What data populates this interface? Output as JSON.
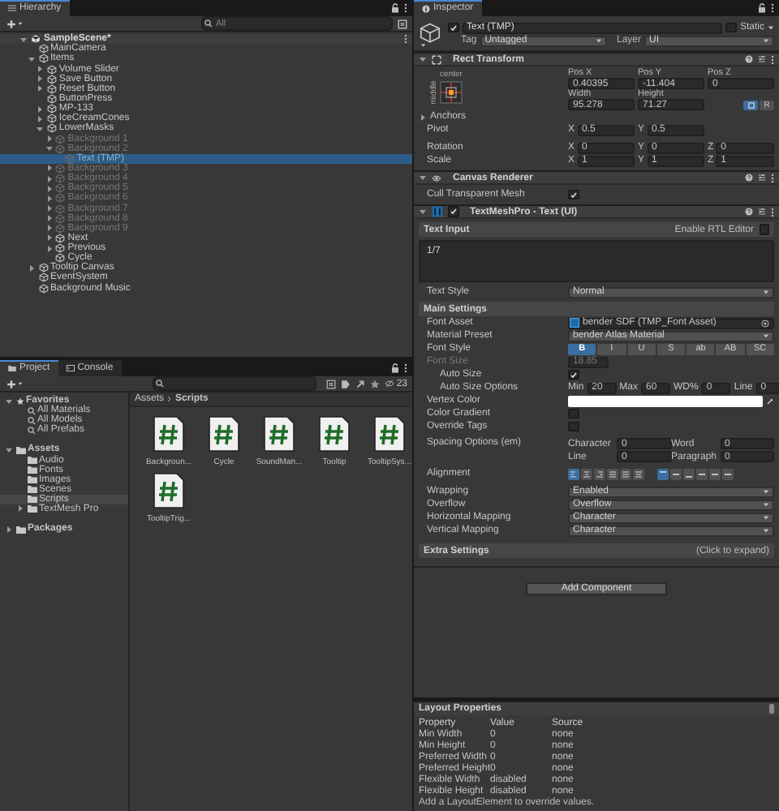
{
  "hierarchy": {
    "title": "Hierarchy",
    "search": {
      "placeholder": "All"
    },
    "scene": {
      "name": "SampleScene*",
      "expanded": true
    },
    "tree": [
      {
        "name": "MainCamera",
        "disabled": false,
        "selected": false
      },
      {
        "name": "Items",
        "expanded": true,
        "disabled": false,
        "selected": false,
        "children": [
          {
            "name": "Volume Slider",
            "expanded": false,
            "disabled": false,
            "selected": false
          },
          {
            "name": "Save Button",
            "expanded": false,
            "disabled": false,
            "selected": false
          },
          {
            "name": "Reset Button",
            "expanded": false,
            "disabled": false,
            "selected": false
          },
          {
            "name": "ButtonPress",
            "disabled": false,
            "selected": false
          },
          {
            "name": "MP-133",
            "expanded": false,
            "disabled": false,
            "selected": false
          },
          {
            "name": "IceCreamCones",
            "expanded": false,
            "disabled": false,
            "selected": false
          },
          {
            "name": "LowerMasks",
            "expanded": true,
            "disabled": false,
            "selected": false,
            "children": [
              {
                "name": "Background 1",
                "expanded": false,
                "disabled": true,
                "selected": false
              },
              {
                "name": "Background 2",
                "expanded": true,
                "disabled": true,
                "selected": false,
                "children": [
                  {
                    "name": "Text (TMP)",
                    "disabled": true,
                    "selected": true
                  }
                ]
              },
              {
                "name": "Background 3",
                "expanded": false,
                "disabled": true,
                "selected": false
              },
              {
                "name": "Background 4",
                "expanded": false,
                "disabled": true,
                "selected": false
              },
              {
                "name": "Background 5",
                "expanded": false,
                "disabled": true,
                "selected": false
              },
              {
                "name": "Background 6",
                "expanded": false,
                "disabled": true,
                "selected": false
              },
              {
                "name": "Background 7",
                "expanded": false,
                "disabled": true,
                "selected": false
              },
              {
                "name": "Background 8",
                "expanded": false,
                "disabled": true,
                "selected": false
              },
              {
                "name": "Background 9",
                "expanded": false,
                "disabled": true,
                "selected": false
              },
              {
                "name": "Next",
                "expanded": false,
                "disabled": false,
                "selected": false
              },
              {
                "name": "Previous",
                "expanded": false,
                "disabled": false,
                "selected": false
              },
              {
                "name": "Cycle",
                "disabled": false,
                "selected": false
              }
            ]
          }
        ]
      },
      {
        "name": "Tooltip Canvas",
        "expanded": false,
        "disabled": false,
        "selected": false
      },
      {
        "name": "EventSystem",
        "disabled": false,
        "selected": false
      },
      {
        "name": "Background Music",
        "disabled": false,
        "selected": false
      }
    ]
  },
  "project": {
    "tabs": [
      {
        "label": "Project",
        "selected": true
      },
      {
        "label": "Console",
        "selected": false
      }
    ],
    "hidden_count": "23",
    "tree": [
      {
        "name": "Favorites",
        "kind": "favorites",
        "expanded": true,
        "selected": false,
        "children": [
          {
            "name": "All Materials",
            "kind": "search",
            "selected": false
          },
          {
            "name": "All Models",
            "kind": "search",
            "selected": false
          },
          {
            "name": "All Prefabs",
            "kind": "search",
            "selected": false
          }
        ]
      },
      {
        "name": "Assets",
        "kind": "folder",
        "expanded": true,
        "selected": false,
        "children": [
          {
            "name": "Audio",
            "kind": "folder",
            "selected": false
          },
          {
            "name": "Fonts",
            "kind": "folder",
            "selected": false
          },
          {
            "name": "Images",
            "kind": "folder",
            "selected": false
          },
          {
            "name": "Scenes",
            "kind": "folder",
            "selected": false
          },
          {
            "name": "Scripts",
            "kind": "folder",
            "selected": true
          },
          {
            "name": "TextMesh Pro",
            "kind": "folder",
            "expanded": false,
            "selected": false
          }
        ]
      },
      {
        "name": "Packages",
        "kind": "folder",
        "expanded": false,
        "selected": false
      }
    ],
    "breadcrumb": [
      "Assets",
      "Scripts"
    ],
    "files": [
      {
        "name": "Backgroun..."
      },
      {
        "name": "Cycle"
      },
      {
        "name": "SoundMan..."
      },
      {
        "name": "Tooltip"
      },
      {
        "name": "TooltipSys..."
      },
      {
        "name": "TooltipTrig..."
      }
    ]
  },
  "inspector": {
    "title": "Inspector",
    "object": {
      "active": true,
      "name": "Text (TMP)",
      "static": false,
      "static_label": "Static",
      "tag_label": "Tag",
      "tag": "Untagged",
      "layer_label": "Layer",
      "layer": "UI"
    },
    "rect_transform": {
      "title": "Rect Transform",
      "anchor_h": "center",
      "anchor_v": "middle",
      "fields": [
        {
          "label": "Pos X",
          "value": "0.40395"
        },
        {
          "label": "Pos Y",
          "value": "-11.404"
        },
        {
          "label": "Pos Z",
          "value": "0"
        },
        {
          "label": "Width",
          "value": "95.278"
        },
        {
          "label": "Height",
          "value": "71.27"
        }
      ],
      "blueprint": true,
      "raw_label": "R",
      "anchors": {
        "label": "Anchors",
        "expanded": false
      },
      "rows": [
        {
          "label": "Pivot",
          "values": [
            {
              "axis": "X",
              "value": "0.5"
            },
            {
              "axis": "Y",
              "value": "0.5"
            }
          ]
        },
        {
          "label": "Rotation",
          "values": [
            {
              "axis": "X",
              "value": "0"
            },
            {
              "axis": "Y",
              "value": "0"
            },
            {
              "axis": "Z",
              "value": "0"
            }
          ]
        },
        {
          "label": "Scale",
          "values": [
            {
              "axis": "X",
              "value": "1"
            },
            {
              "axis": "Y",
              "value": "1"
            },
            {
              "axis": "Z",
              "value": "1"
            }
          ]
        }
      ]
    },
    "canvas_renderer": {
      "title": "Canvas Renderer",
      "rows": [
        {
          "label": "Cull Transparent Mesh",
          "checked": true
        }
      ]
    },
    "tmp": {
      "title": "TextMeshPro - Text (UI)",
      "enabled": true,
      "text_input": {
        "title": "Text Input",
        "rtl_label": "Enable RTL Editor",
        "rtl": false,
        "value": "1/7"
      },
      "rows": [
        {
          "kind": "dropdown",
          "label": "Text Style",
          "value": "Normal"
        },
        {
          "kind": "header",
          "label": "Main Settings"
        },
        {
          "kind": "object",
          "label": "Font Asset",
          "value": "bender SDF (TMP_Font Asset)"
        },
        {
          "kind": "dropdown",
          "label": "Material Preset",
          "value": "bender Atlas Material"
        },
        {
          "kind": "buttons",
          "label": "Font Style",
          "buttons": [
            {
              "label": "B",
              "selected": true
            },
            {
              "label": "I",
              "selected": false
            },
            {
              "label": "U",
              "selected": false
            },
            {
              "label": "S",
              "selected": false
            },
            {
              "label": "ab",
              "selected": false
            },
            {
              "label": "AB",
              "selected": false
            },
            {
              "label": "SC",
              "selected": false
            }
          ]
        },
        {
          "kind": "number",
          "label": "Font Size",
          "value": "18.85",
          "disabled": true,
          "children": [
            {
              "kind": "check",
              "label": "Auto Size",
              "checked": true
            },
            {
              "kind": "pairs",
              "label": "Auto Size Options",
              "fields": [
                {
                  "label": "Min",
                  "value": "20"
                },
                {
                  "label": "Max",
                  "value": "60"
                },
                {
                  "label": "WD%",
                  "value": "0"
                },
                {
                  "label": "Line",
                  "value": "0"
                }
              ]
            }
          ]
        },
        {
          "kind": "color",
          "label": "Vertex Color",
          "color": "#ffffff"
        },
        {
          "kind": "check",
          "label": "Color Gradient",
          "checked": false
        },
        {
          "kind": "check",
          "label": "Override Tags",
          "checked": false
        },
        {
          "kind": "grid",
          "label": "Spacing Options (em)",
          "fields": [
            {
              "label": "Character",
              "value": "0"
            },
            {
              "label": "Word",
              "value": "0"
            },
            {
              "label": "Line",
              "value": "0"
            },
            {
              "label": "Paragraph",
              "value": "0"
            }
          ]
        },
        {
          "kind": "alignment",
          "label": "Alignment",
          "horizontal": [
            {
              "selected": true
            },
            {
              "selected": false
            },
            {
              "selected": false
            },
            {
              "selected": false
            },
            {
              "selected": false
            },
            {
              "selected": false
            }
          ],
          "vertical": [
            {
              "selected": true
            },
            {
              "selected": false
            },
            {
              "selected": false
            },
            {
              "selected": false
            },
            {
              "selected": false
            },
            {
              "selected": false
            }
          ]
        },
        {
          "kind": "dropdown",
          "label": "Wrapping",
          "value": "Enabled"
        },
        {
          "kind": "dropdown",
          "label": "Overflow",
          "value": "Overflow"
        },
        {
          "kind": "dropdown",
          "label": "Horizontal Mapping",
          "value": "Character"
        },
        {
          "kind": "dropdown",
          "label": "Vertical Mapping",
          "value": "Character"
        },
        {
          "kind": "foldout",
          "label": "Extra Settings",
          "hint": "(Click to expand)",
          "expanded": false
        }
      ]
    },
    "add_component": "Add Component"
  },
  "layout_properties": {
    "title": "Layout Properties",
    "columns": [
      "Property",
      "Value",
      "Source"
    ],
    "rows": [
      [
        "Min Width",
        "0",
        "none"
      ],
      [
        "Min Height",
        "0",
        "none"
      ],
      [
        "Preferred Width",
        "0",
        "none"
      ],
      [
        "Preferred Height",
        "0",
        "none"
      ],
      [
        "Flexible Width",
        "disabled",
        "none"
      ],
      [
        "Flexible Height",
        "disabled",
        "none"
      ]
    ],
    "note": "Add a LayoutElement to override values."
  }
}
